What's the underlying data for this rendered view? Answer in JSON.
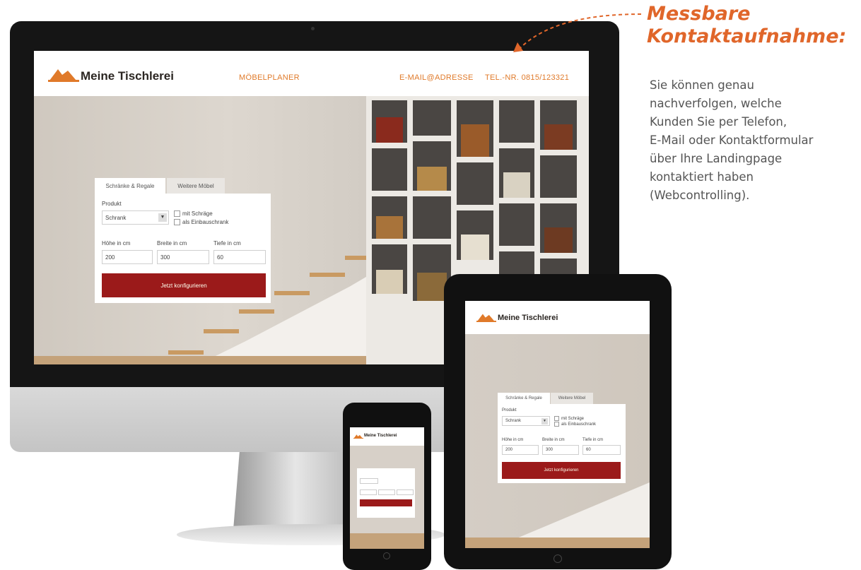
{
  "desktop": {
    "brand": "Meine Tischlerei",
    "nav": {
      "planner": "MÖBELPLANER",
      "email": "E-MAIL@ADRESSE",
      "phone": "TEL.-NR. 0815/123321"
    },
    "configurator": {
      "tabs": [
        "Schränke & Regale",
        "Weitere Möbel"
      ],
      "product_label": "Produkt",
      "product_value": "Schrank",
      "checkboxes": [
        "mit Schräge",
        "als Einbauschrank"
      ],
      "height_label": "Höhe in cm",
      "width_label": "Breite in cm",
      "depth_label": "Tiefe in cm",
      "height_value": "200",
      "width_value": "300",
      "depth_value": "60",
      "submit_label": "Jetzt konfigurieren"
    }
  },
  "tablet": {
    "brand": "Meine Tischlerei",
    "configurator": {
      "tabs": [
        "Schränke & Regale",
        "Weitere Möbel"
      ],
      "product_label": "Produkt",
      "product_value": "Schrank",
      "checkboxes": [
        "mit Schräge",
        "als Einbauschrank"
      ],
      "height_label": "Höhe in cm",
      "width_label": "Breite in cm",
      "depth_label": "Tiefe in cm",
      "height_value": "200",
      "width_value": "300",
      "depth_value": "60",
      "submit_label": "Jetzt konfigurieren"
    }
  },
  "phone": {
    "brand": "Meine Tischlerei"
  },
  "annotation": {
    "title_line1": "Messbare",
    "title_line2": "Kontaktaufnahme:",
    "body_lines": [
      "Sie können genau",
      "nachverfolgen, welche",
      "Kunden Sie per Telefon,",
      "E-Mail oder Kontaktformular",
      "über Ihre Landingpage",
      "kontaktiert haben",
      "(Webcontrolling)."
    ]
  },
  "colors": {
    "brand_orange": "#e07a2a",
    "cta_red": "#9b1a1a",
    "note_orange": "#e0662a"
  }
}
